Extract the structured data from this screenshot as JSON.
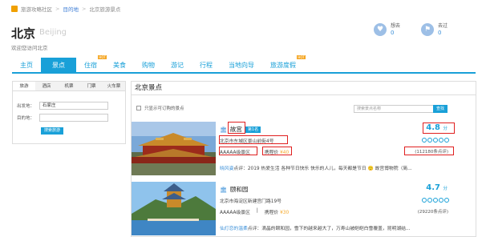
{
  "breadcrumb": {
    "items": [
      "旅游攻略社区",
      "目的地",
      "北京旅游景点"
    ],
    "sep": ">"
  },
  "city": {
    "name": "北京",
    "name_en": "Beijing",
    "welcome": "欢迎您访问北京"
  },
  "stats": [
    {
      "label": "想去",
      "count": "0",
      "icon": "heart-icon"
    },
    {
      "label": "去过",
      "count": "0",
      "icon": "flag-icon"
    }
  ],
  "nav": {
    "tabs": [
      {
        "label": "主页",
        "hot": false
      },
      {
        "label": "景点",
        "hot": false,
        "active": true
      },
      {
        "label": "住宿",
        "hot": true
      },
      {
        "label": "美食",
        "hot": false
      },
      {
        "label": "购物",
        "hot": false
      },
      {
        "label": "游记",
        "hot": false
      },
      {
        "label": "行程",
        "hot": false
      },
      {
        "label": "当地向导",
        "hot": false
      },
      {
        "label": "旅游度假",
        "hot": true
      }
    ],
    "hot_label": "HOT"
  },
  "search_panel": {
    "tabs": [
      "旅游",
      "酒店",
      "机票",
      "门票",
      "火车票"
    ],
    "from_label": "出发地：",
    "from_value": "石家庄",
    "to_label": "目的地：",
    "to_value": "",
    "button": "搜索旅游"
  },
  "main": {
    "heading": "北京景点",
    "filter_label": "只显示可订购的景点",
    "search_placeholder": "搜索景点名称",
    "search_button": "查找",
    "items": [
      {
        "name": "故宫",
        "rank": "第1名",
        "address": "北京市东城区景山前街4号",
        "level": "AAAAA级景区",
        "price_label": "携程价",
        "price": "¥40",
        "score": "4.8",
        "score_unit": "分",
        "reviews": "(112180条点评)",
        "comment_user": "晓风姿",
        "comment_suffix": "点评：",
        "comment": "2019 热爱生活 各种节日快乐 快乐的人儿，每天都是节日 🙂 故宫博物院（简..."
      },
      {
        "name": "颐和园",
        "rank": "",
        "address": "北京市海淀区新建宫门路19号",
        "level": "AAAAA级景区",
        "price_label": "携程价",
        "price": "¥30",
        "score": "4.7",
        "score_unit": "分",
        "reviews": "(29220条点评)",
        "comment_user": "仙灯恋的温柔",
        "comment_suffix": "点评：",
        "comment": "滴晶的颐和园，雪下的越来越大了，万寿山被皑皑白雪覆盖，昆明湖结..."
      }
    ]
  },
  "colors": {
    "accent": "#19a0d8",
    "highlight": "#e02020",
    "price": "#f5a623",
    "hot": "#f5a623"
  }
}
